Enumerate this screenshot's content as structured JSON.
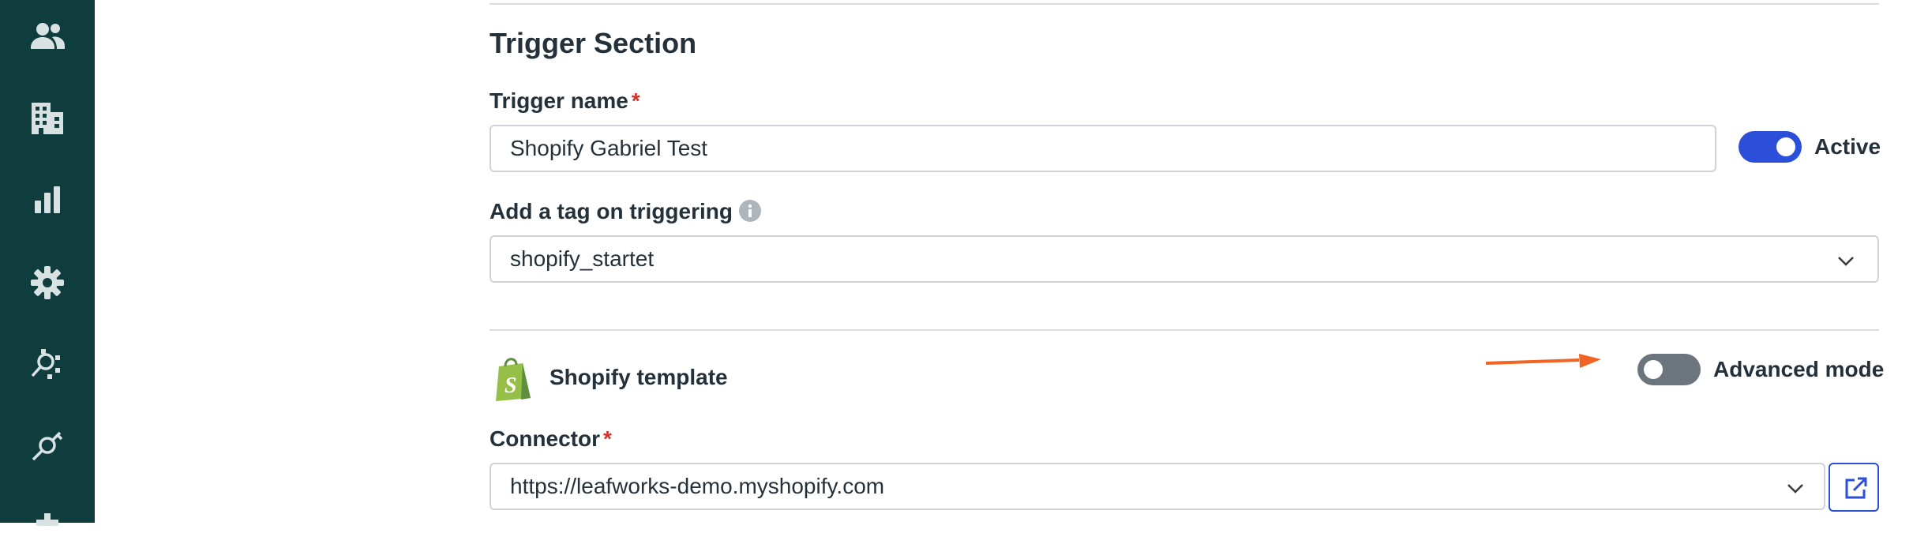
{
  "sidebar": {
    "items": [
      {
        "icon": "users-icon"
      },
      {
        "icon": "buildings-icon"
      },
      {
        "icon": "bar-chart-icon"
      },
      {
        "icon": "gear-icon"
      },
      {
        "icon": "integration-search-icon"
      },
      {
        "icon": "plug-search-icon"
      }
    ],
    "background": "#0f3d3e",
    "icon_color": "#d8e2e3"
  },
  "trigger_section": {
    "title": "Trigger Section",
    "trigger_name": {
      "label": "Trigger name",
      "required": "*",
      "value": "Shopify Gabriel Test"
    },
    "active_toggle": {
      "label": "Active",
      "on": true,
      "color": "#2b4fd8"
    },
    "tag": {
      "label": "Add a tag on triggering",
      "info_icon": "info-icon",
      "value": "shopify_startet",
      "dropdown_icon": "chevron-down-icon"
    }
  },
  "shopify": {
    "logo_icon": "shopify-bag-icon",
    "template_label": "Shopify template",
    "advanced_mode": {
      "label": "Advanced mode",
      "on": false,
      "color": "#6c757d"
    },
    "annotation_arrow": {
      "icon": "arrow-right-icon",
      "color": "#f06424"
    },
    "connector": {
      "label": "Connector",
      "required": "*",
      "value": "https://leafworks-demo.myshopify.com",
      "dropdown_icon": "chevron-down-icon",
      "open_icon": "external-link-icon"
    }
  }
}
